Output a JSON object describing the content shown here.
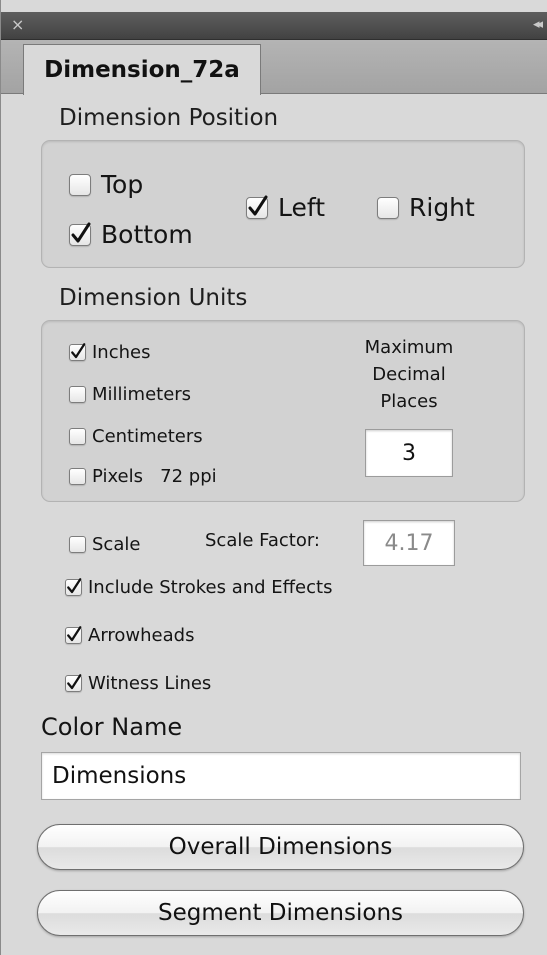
{
  "panel": {
    "close_glyph": "×",
    "collapse_glyph": "◂◂",
    "tab_title": "Dimension_72a"
  },
  "position": {
    "heading": "Dimension Position",
    "top": {
      "label": "Top",
      "checked": false
    },
    "bottom": {
      "label": "Bottom",
      "checked": true
    },
    "left": {
      "label": "Left",
      "checked": true
    },
    "right": {
      "label": "Right",
      "checked": false
    }
  },
  "units": {
    "heading": "Dimension Units",
    "inches": {
      "label": "Inches",
      "checked": true
    },
    "millimeters": {
      "label": "Millimeters",
      "checked": false
    },
    "centimeters": {
      "label": "Centimeters",
      "checked": false
    },
    "pixels": {
      "label": "Pixels   72 ppi",
      "checked": false
    },
    "max_decimal_label_1": "Maximum",
    "max_decimal_label_2": "Decimal",
    "max_decimal_label_3": "Places",
    "max_decimal_value": "3"
  },
  "options": {
    "scale": {
      "label": "Scale",
      "checked": false
    },
    "scale_factor_label": "Scale Factor:",
    "scale_factor_value": "4.17",
    "strokes": {
      "label": "Include Strokes and Effects",
      "checked": true
    },
    "arrowheads": {
      "label": "Arrowheads",
      "checked": true
    },
    "witness": {
      "label": "Witness Lines",
      "checked": true
    }
  },
  "color": {
    "label": "Color Name",
    "value": "Dimensions"
  },
  "buttons": {
    "overall": "Overall Dimensions",
    "segment": "Segment Dimensions"
  }
}
